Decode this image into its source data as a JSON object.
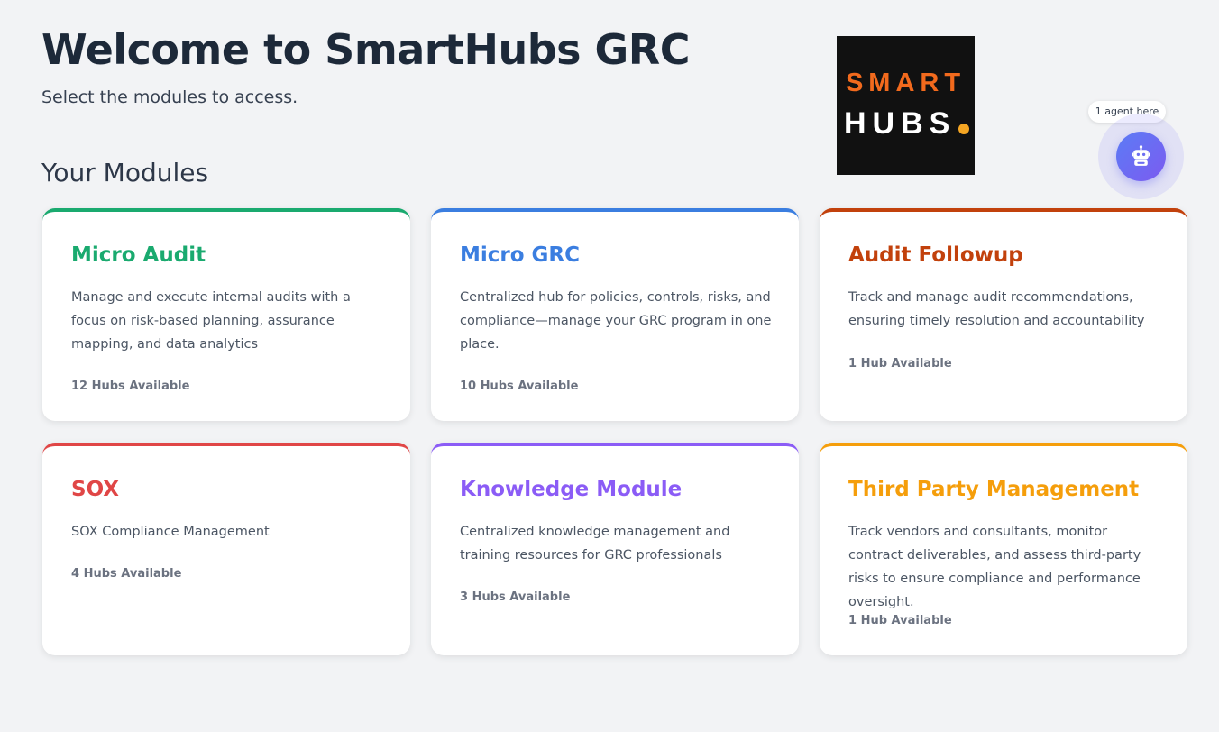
{
  "header": {
    "title": "Welcome to SmartHubs GRC",
    "subtitle": "Select the modules to access."
  },
  "section": {
    "title": "Your Modules"
  },
  "logo": {
    "line1": "SMART",
    "line2": "HUBS",
    "text_color_top": "#f26a1d",
    "dot_color": "#f5a623",
    "background": "#111111"
  },
  "agent": {
    "tooltip": "1 agent here",
    "icon": "robot-icon"
  },
  "modules": [
    {
      "title": "Micro Audit",
      "color": "#1aaa6f",
      "description": "Manage and execute internal audits with a focus on risk-based planning, assurance mapping, and data analytics",
      "hubs": "12 Hubs Available"
    },
    {
      "title": "Micro GRC",
      "color": "#3b7ee0",
      "description": "Centralized hub for policies, controls, risks, and compliance—manage your GRC program in one place.",
      "hubs": "10 Hubs Available"
    },
    {
      "title": "Audit Followup",
      "color": "#c2410c",
      "description": "Track and manage audit recommendations, ensuring timely resolution and accountability",
      "hubs": "1 Hub Available"
    },
    {
      "title": "SOX",
      "color": "#e04646",
      "description": "SOX Compliance Management",
      "hubs": "4 Hubs Available"
    },
    {
      "title": "Knowledge Module",
      "color": "#8b5cf6",
      "description": "Centralized knowledge management and training resources for GRC professionals",
      "hubs": "3 Hubs Available"
    },
    {
      "title": "Third Party Management",
      "color": "#f59e0b",
      "description": "Track vendors and consultants, monitor contract deliverables, and assess third-party risks to ensure compliance and performance oversight.",
      "hubs": "1 Hub Available"
    }
  ]
}
